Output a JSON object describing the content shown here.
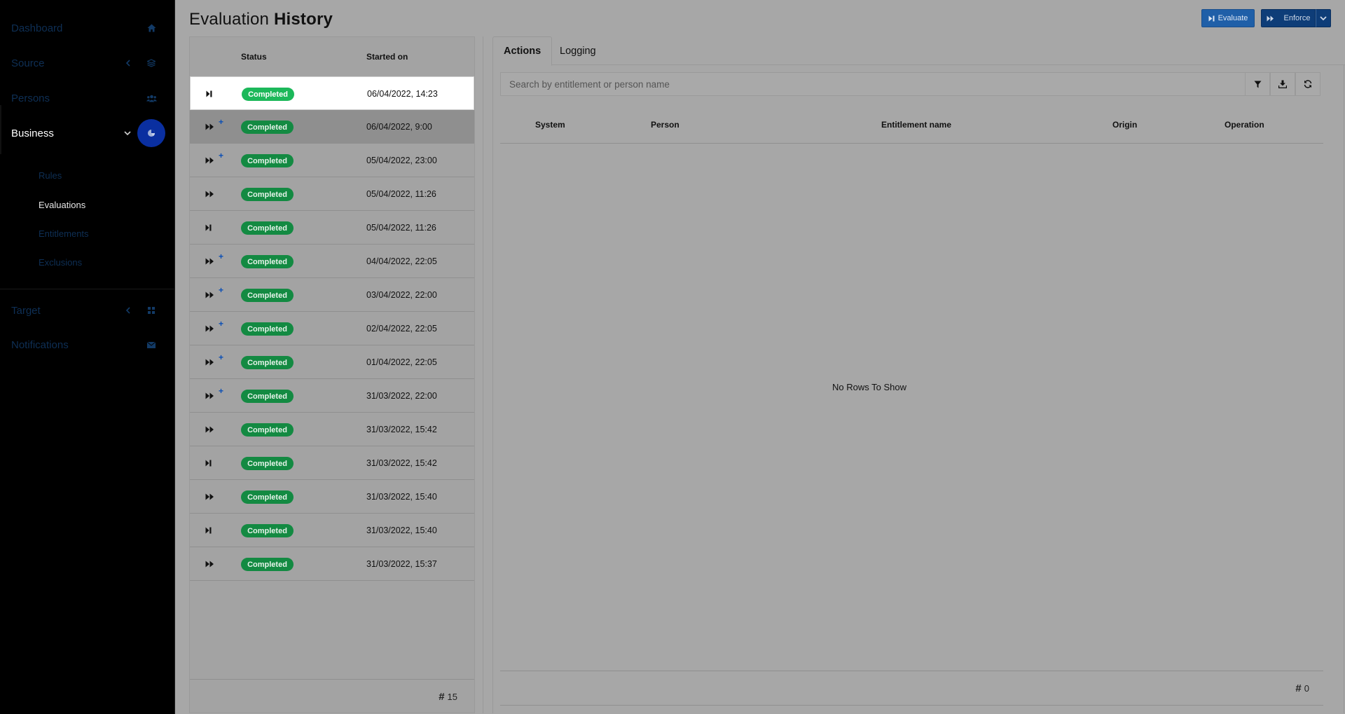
{
  "sidebar": {
    "items": [
      {
        "label": "Dashboard",
        "icon": "home-icon"
      },
      {
        "label": "Source",
        "icon": "database-icon"
      },
      {
        "label": "Persons",
        "icon": "users-icon"
      },
      {
        "label": "Business",
        "icon": "chart-pie-icon"
      },
      {
        "label": "Target",
        "icon": "grid-icon"
      },
      {
        "label": "Notifications",
        "icon": "envelope-icon"
      }
    ],
    "business_subitems": [
      "Rules",
      "Evaluations",
      "Entitlements",
      "Exclusions"
    ]
  },
  "page": {
    "title_light": "Evaluation",
    "title_bold": "History"
  },
  "toolbar": {
    "evaluate_label": "Evaluate",
    "enforce_label": "Enforce"
  },
  "history": {
    "columns": {
      "status": "Status",
      "started_on": "Started on"
    },
    "rows": [
      {
        "type": "single",
        "plus": false,
        "status": "Completed",
        "date": "06/04/2022, 14:23"
      },
      {
        "type": "double",
        "plus": true,
        "status": "Completed",
        "date": "06/04/2022, 9:00"
      },
      {
        "type": "double",
        "plus": true,
        "status": "Completed",
        "date": "05/04/2022, 23:00"
      },
      {
        "type": "double",
        "plus": false,
        "status": "Completed",
        "date": "05/04/2022, 11:26"
      },
      {
        "type": "single",
        "plus": false,
        "status": "Completed",
        "date": "05/04/2022, 11:26"
      },
      {
        "type": "double",
        "plus": true,
        "status": "Completed",
        "date": "04/04/2022, 22:05"
      },
      {
        "type": "double",
        "plus": true,
        "status": "Completed",
        "date": "03/04/2022, 22:00"
      },
      {
        "type": "double",
        "plus": true,
        "status": "Completed",
        "date": "02/04/2022, 22:05"
      },
      {
        "type": "double",
        "plus": true,
        "status": "Completed",
        "date": "01/04/2022, 22:05"
      },
      {
        "type": "double",
        "plus": true,
        "status": "Completed",
        "date": "31/03/2022, 22:00"
      },
      {
        "type": "double",
        "plus": false,
        "status": "Completed",
        "date": "31/03/2022, 15:42"
      },
      {
        "type": "single",
        "plus": false,
        "status": "Completed",
        "date": "31/03/2022, 15:42"
      },
      {
        "type": "double",
        "plus": false,
        "status": "Completed",
        "date": "31/03/2022, 15:40"
      },
      {
        "type": "single",
        "plus": false,
        "status": "Completed",
        "date": "31/03/2022, 15:40"
      },
      {
        "type": "double",
        "plus": false,
        "status": "Completed",
        "date": "31/03/2022, 15:37"
      }
    ],
    "count": "15"
  },
  "tabs": [
    "Actions",
    "Logging"
  ],
  "actions": {
    "search_placeholder": "Search by entitlement or person name",
    "columns": [
      "System",
      "Person",
      "Entitlement name",
      "Origin",
      "Operation"
    ],
    "empty_text": "No Rows To Show",
    "count": "0"
  },
  "colors": {
    "accent": "#0a2fa0",
    "status_completed": "#138a42",
    "plus_marker": "#0b4fb5"
  }
}
